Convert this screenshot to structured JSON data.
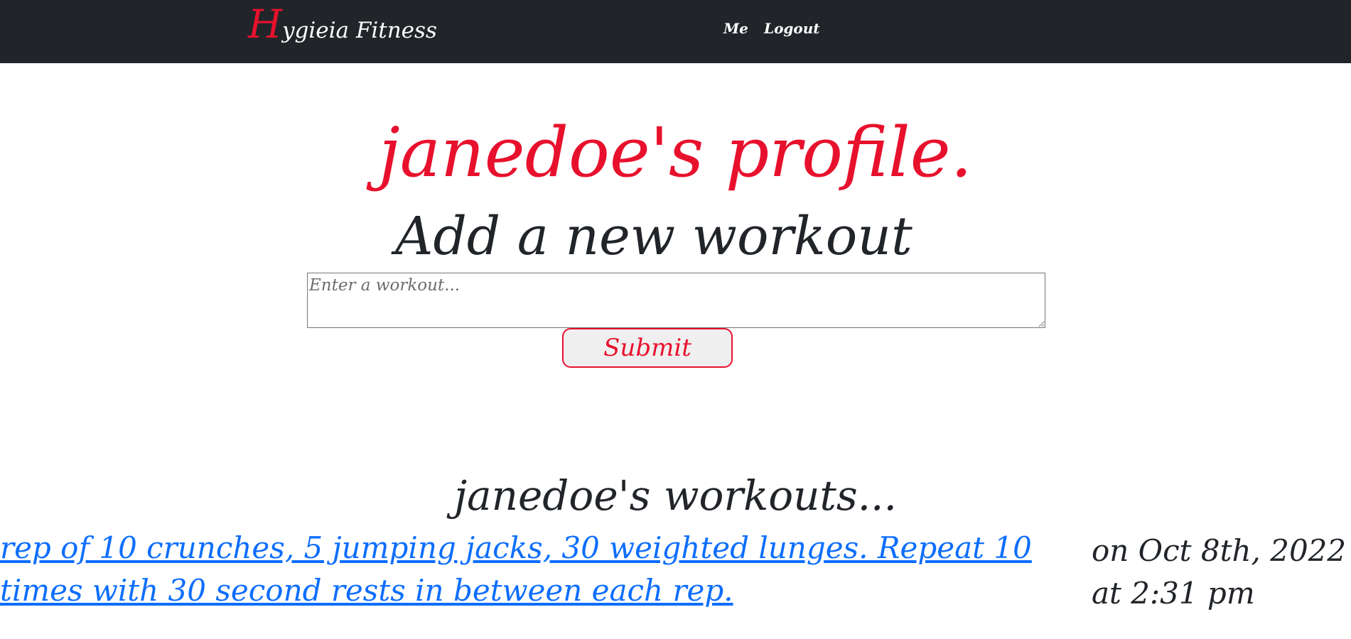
{
  "navbar": {
    "brand_first_letter": "H",
    "brand_rest": "ygieia Fitness",
    "links": [
      "Me",
      "Logout"
    ]
  },
  "profile": {
    "title": "janedoe's profile."
  },
  "add_workout": {
    "heading": "Add a new workout",
    "input_placeholder": "Enter a workout...",
    "input_value": "",
    "submit_label": "Submit"
  },
  "workouts": {
    "heading": "janedoe's workouts...",
    "items": [
      {
        "text": "rep of 10 crunches, 5 jumping jacks, 30 weighted lunges. Repeat 10 times with 30 second rests in between each rep.",
        "date": "on Oct 8th, 2022 at 2:31 pm"
      }
    ]
  },
  "colors": {
    "navbar_bg": "#212529",
    "accent_red": "#e8112d",
    "link_blue": "#0d6efd",
    "text_dark": "#212529"
  }
}
